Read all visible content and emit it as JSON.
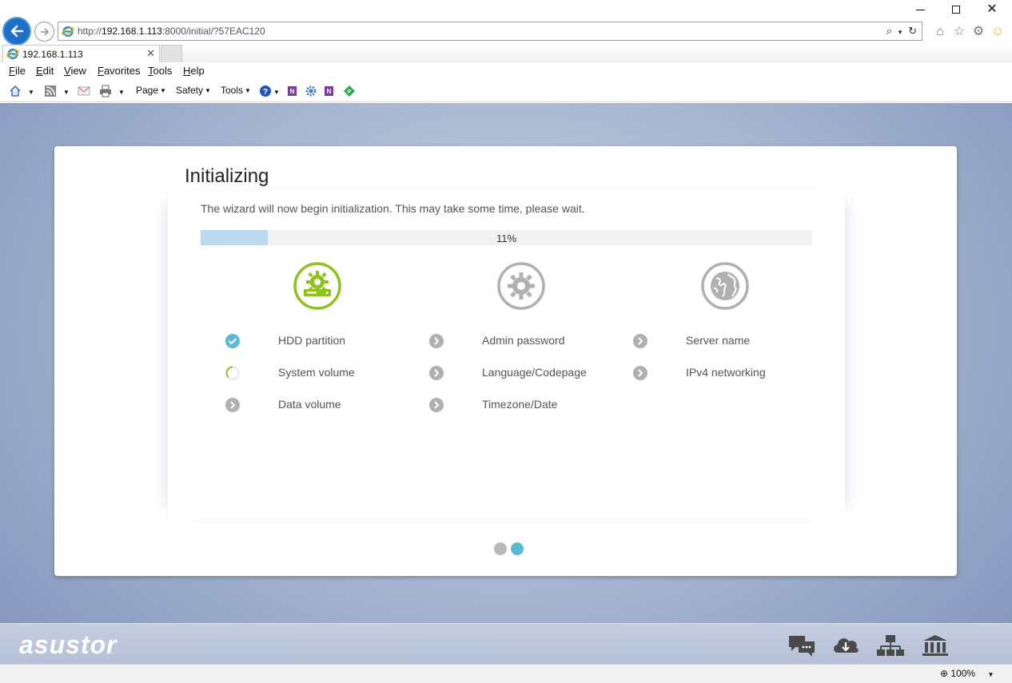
{
  "browser": {
    "url_prefix": "http://",
    "url_host": "192.168.1.113",
    "url_rest": ":8000/initial/?57EAC120",
    "tab_title": "192.168.1.113",
    "menu": [
      "File",
      "Edit",
      "View",
      "Favorites",
      "Tools",
      "Help"
    ],
    "commands": {
      "page": "Page",
      "safety": "Safety",
      "tools": "Tools"
    },
    "zoom": "100%"
  },
  "wizard": {
    "title": "Initializing",
    "description": "The wizard will now begin initialization. This may take some time, please wait.",
    "progress_value": 11,
    "progress_label": "11%",
    "columns": [
      {
        "icon": "hdd-gear-icon",
        "active": true,
        "steps": [
          {
            "label": "HDD partition",
            "status": "done"
          },
          {
            "label": "System volume",
            "status": "in-progress"
          },
          {
            "label": "Data volume",
            "status": "pending"
          }
        ]
      },
      {
        "icon": "gear-icon",
        "active": false,
        "steps": [
          {
            "label": "Admin password",
            "status": "pending"
          },
          {
            "label": "Language/Codepage",
            "status": "pending"
          },
          {
            "label": "Timezone/Date",
            "status": "pending"
          }
        ]
      },
      {
        "icon": "globe-icon",
        "active": false,
        "steps": [
          {
            "label": "Server name",
            "status": "pending"
          },
          {
            "label": "IPv4 networking",
            "status": "pending"
          }
        ]
      }
    ],
    "pagination": {
      "pages": 2,
      "current": 2
    }
  },
  "taskbar": {
    "logo": "asustor",
    "icons": [
      "chat-icon",
      "cloud-download-icon",
      "network-icon",
      "bank-icon"
    ]
  },
  "colors": {
    "accent_green": "#8dc21f",
    "check_blue": "#5bb8d6",
    "pending_grey": "#b0b0b0",
    "progress_fill": "#bcd9f0",
    "dot_active": "#5bb8d6",
    "dot_inactive": "#b8b8b8"
  }
}
